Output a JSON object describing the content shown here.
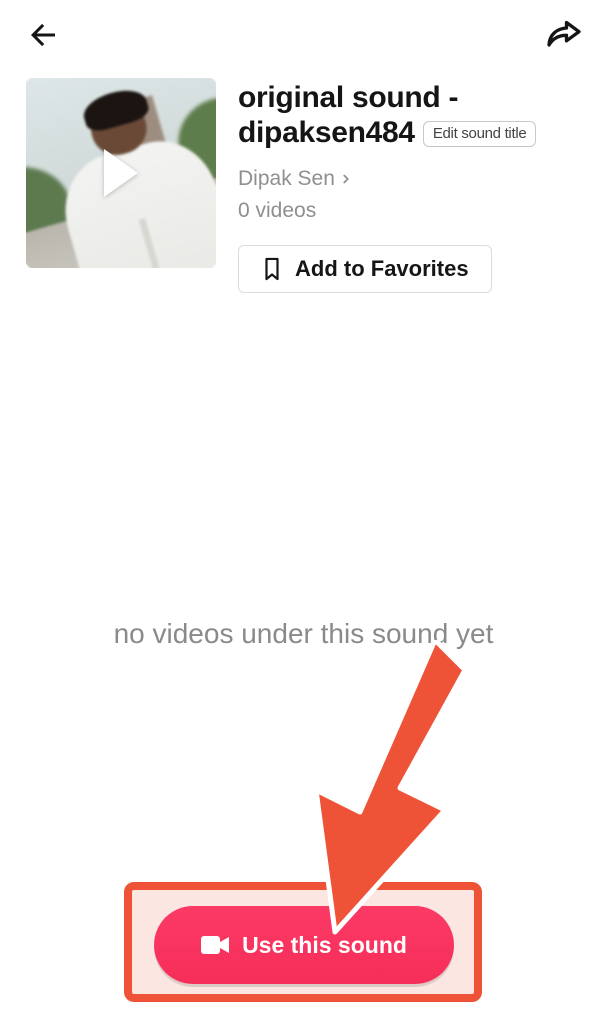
{
  "sound": {
    "title_line1": "original sound -",
    "title_line2": "dipaksen484",
    "edit_label": "Edit sound title",
    "author": "Dipak Sen",
    "video_count": "0 videos"
  },
  "favorites_label": "Add to Favorites",
  "empty_state": "no videos under this sound yet",
  "cta_label": "Use this sound"
}
